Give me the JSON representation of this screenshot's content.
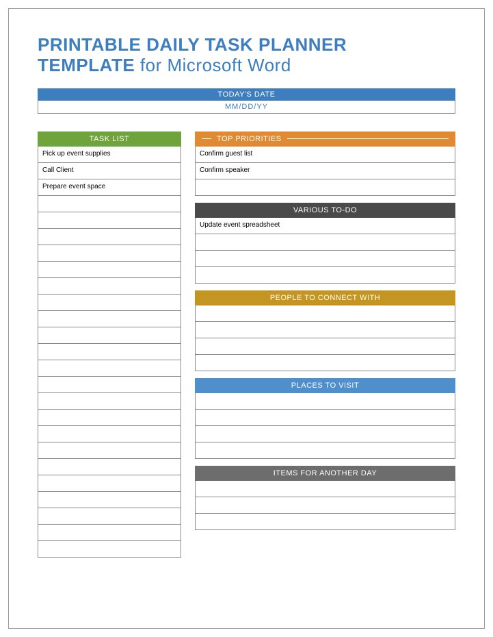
{
  "title_line1": "PRINTABLE DAILY TASK PLANNER",
  "title_line2_a": "TEMPLATE ",
  "title_line2_b": "for Microsoft Word",
  "date": {
    "header": "TODAY'S DATE",
    "value": "MM/DD/YY"
  },
  "task_list": {
    "header": "TASK LIST",
    "rows": [
      "Pick up event supplies",
      "Call Client",
      "Prepare event space",
      "",
      "",
      "",
      "",
      "",
      "",
      "",
      "",
      "",
      "",
      "",
      "",
      "",
      "",
      "",
      "",
      "",
      "",
      "",
      "",
      "",
      ""
    ]
  },
  "top_priorities": {
    "header": "TOP PRIORITIES",
    "rows": [
      "Confirm guest list",
      "Confirm speaker",
      ""
    ]
  },
  "various_todo": {
    "header": "VARIOUS TO-DO",
    "rows": [
      "Update event spreadsheet",
      "",
      "",
      ""
    ]
  },
  "people": {
    "header": "PEOPLE TO CONNECT WITH",
    "rows": [
      "",
      "",
      "",
      ""
    ]
  },
  "places": {
    "header": "PLACES TO VISIT",
    "rows": [
      "",
      "",
      "",
      ""
    ]
  },
  "another_day": {
    "header": "ITEMS FOR ANOTHER DAY",
    "rows": [
      "",
      "",
      ""
    ]
  }
}
